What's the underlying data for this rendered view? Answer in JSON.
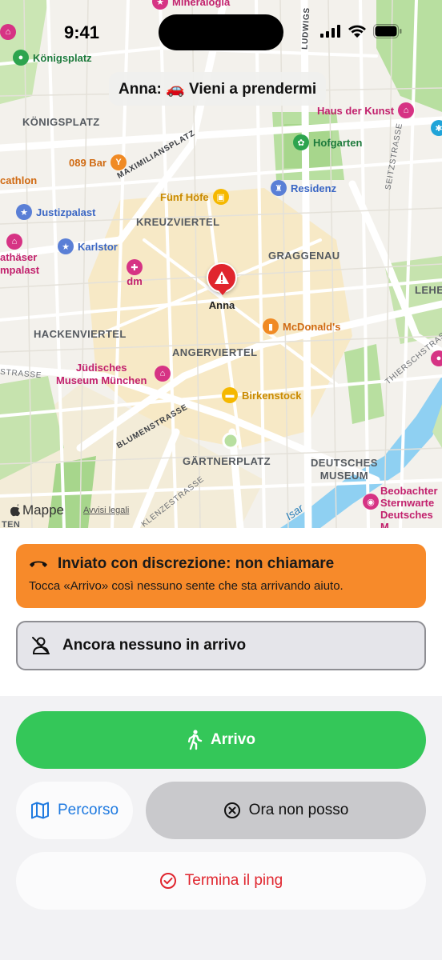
{
  "status_bar": {
    "time": "9:41"
  },
  "map": {
    "title": "Anna: 🚗 Vieni a prendermi",
    "pin_label": "Anna",
    "logo": "Mappe",
    "legal": "Avvisi legali",
    "pois": {
      "mineralogia": "Mineralogia",
      "koenigsplatz": "Königsplatz",
      "haus_der_kunst": "Haus der Kunst",
      "hofgarten": "Hofgarten",
      "bar089": "089 Bar",
      "cathlon": "cathlon",
      "fuenf_hoefe": "Fünf Höfe",
      "residenz": "Residenz",
      "justizpalast": "Justizpalast",
      "karlstor": "Karlstor",
      "rathauser_1": "athäser",
      "rathauser_2": "mpalast",
      "dm": "dm",
      "mcdonalds": "McDonald's",
      "juedisches_1": "Jüdisches",
      "juedisches_2": "Museum München",
      "birkenstock": "Birkenstock",
      "beobachter_1": "Beobachter",
      "beobachter_2": "Sternwarte",
      "beobachter_3": "Deutsches M"
    },
    "areas": {
      "koenigsplatz": "KÖNIGSPLATZ",
      "kreuzviertel": "KREUZVIERTEL",
      "graggenau": "GRAGGENAU",
      "lehel": "LEHE",
      "hackenviertel": "HACKENVIERTEL",
      "angerviertel": "ANGERVIERTEL",
      "gaertnerplatz": "GÄRTNERPLATZ",
      "deutsches_museum_1": "DEUTSCHES",
      "deutsches_museum_2": "MUSEUM",
      "ten": "TEN"
    },
    "streets": {
      "ludwigs": "LUDWIGS",
      "maximiliansplatz": "MAXIMILIANSPLATZ",
      "seitzstrasse": "SEITZSTRASSE",
      "thierschstrasse": "THIERSCHSTRASSE",
      "blumenstrasse": "BLUMENSTRASSE",
      "klenzestrasse": "KLENZESTRASSE",
      "strasse_left": "STRASSE",
      "isar": "Isar"
    }
  },
  "alert": {
    "title": "Inviato con discrezione: non chiamare",
    "subtitle": "Tocca «Arrivo» così nessuno sente che sta arrivando aiuto."
  },
  "responders": {
    "label": "Ancora nessuno in arrivo"
  },
  "actions": {
    "arrivo": "Arrivo",
    "percorso": "Percorso",
    "non_posso": "Ora non posso",
    "termina": "Termina il ping"
  },
  "colors": {
    "accent_green": "#34c759",
    "alert_orange": "#f78a2a",
    "danger_red": "#e0252e",
    "link_blue": "#1f7ae0"
  }
}
